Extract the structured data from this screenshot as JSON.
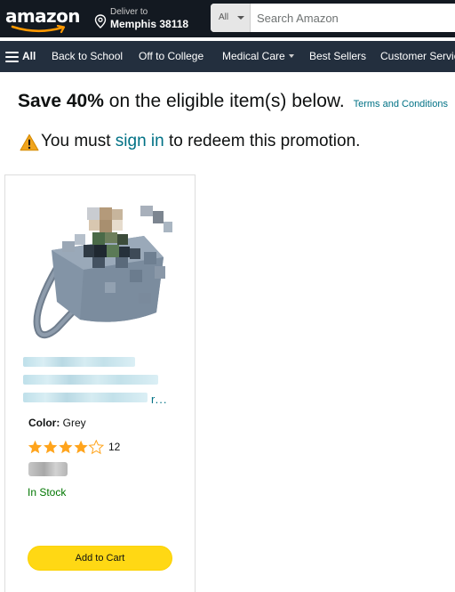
{
  "header": {
    "logo_text": "amazon",
    "deliver_line1": "Deliver to",
    "deliver_line2": "Memphis 38118",
    "search_dept": "All",
    "search_placeholder": "Search Amazon",
    "colors": {
      "nav_bg": "#131921",
      "subnav_bg": "#232f3e",
      "logo_smile": "#ff9900"
    }
  },
  "subnav": {
    "all_label": "All",
    "links": [
      "Back to School",
      "Off to College",
      "Medical Care",
      "Best Sellers",
      "Customer Service"
    ]
  },
  "promotion": {
    "save_bold": "Save 40%",
    "save_rest": "on the eligible item(s) below.",
    "terms_link": "Terms and Conditions",
    "signin_prefix": "You must",
    "signin_link": "sign in",
    "signin_suffix": "to redeem this promotion."
  },
  "product": {
    "title_ellipsis": "r...",
    "color_label": "Color:",
    "color_value": "Grey",
    "rating": 4.5,
    "rating_count": "12",
    "stock_status": "In Stock",
    "add_to_cart_label": "Add to Cart",
    "colors": {
      "star": "#ffa41c",
      "stock": "#007600",
      "button": "#ffd814",
      "link": "#007185"
    }
  }
}
